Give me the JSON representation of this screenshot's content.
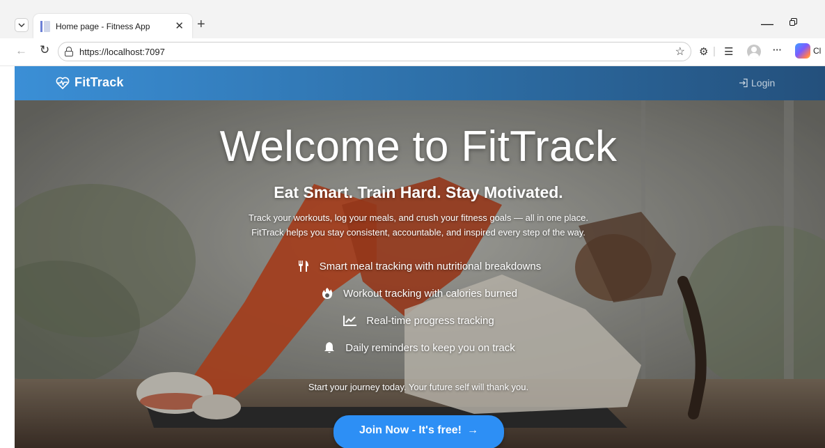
{
  "browser": {
    "tab_title": "Home page - Fitness App",
    "tab_close": "✕",
    "new_tab": "+",
    "url": "https://localhost:7097",
    "copilot_label": "Cl",
    "more": "···"
  },
  "navbar": {
    "brand": "FitTrack",
    "login_label": "Login"
  },
  "hero": {
    "title": "Welcome to FitTrack",
    "subtitle": "Eat Smart. Train Hard. Stay Motivated.",
    "description_line1": "Track your workouts, log your meals, and crush your fitness goals — all in one place.",
    "description_line2": "FitTrack helps you stay consistent, accountable, and inspired every step of the way.",
    "features": [
      {
        "icon": "utensils-icon",
        "label": "Smart meal tracking with nutritional breakdowns"
      },
      {
        "icon": "fire-icon",
        "label": "Workout tracking with calories burned"
      },
      {
        "icon": "chart-line-icon",
        "label": "Real-time progress tracking"
      },
      {
        "icon": "bell-icon",
        "label": "Daily reminders to keep you on track"
      }
    ],
    "cta_text": "Start your journey today. Your future self will thank you.",
    "join_button": "Join Now - It's free!",
    "join_arrow": "→"
  },
  "colors": {
    "navbar_start": "#3b8fd6",
    "navbar_end": "#24507c",
    "button": "#2d8ff5"
  }
}
